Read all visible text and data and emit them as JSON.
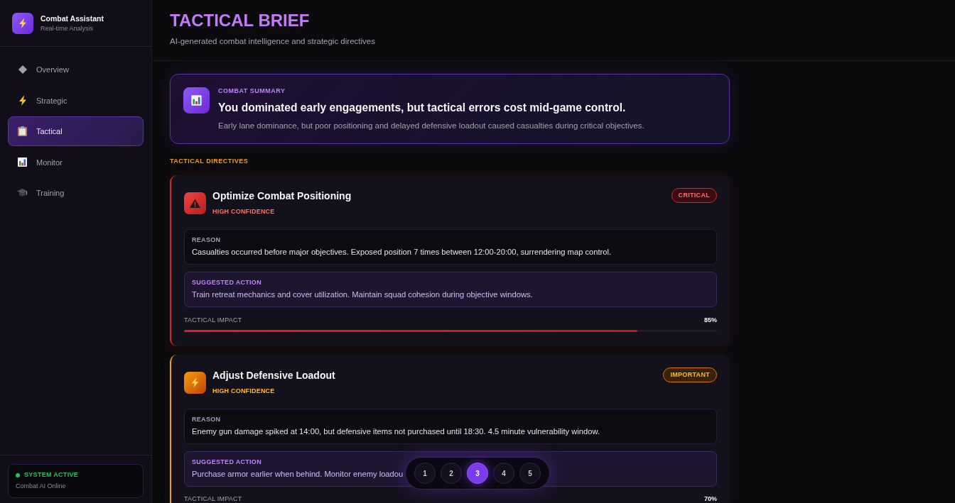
{
  "sidebar": {
    "app_title": "Combat Assistant",
    "app_subtitle": "Real-time Analysis",
    "nav_items": [
      {
        "label": "Overview",
        "selected": false
      },
      {
        "label": "Strategic",
        "selected": false
      },
      {
        "label": "Tactical",
        "selected": true
      },
      {
        "label": "Monitor",
        "selected": false
      },
      {
        "label": "Training",
        "selected": false
      }
    ],
    "status": {
      "label": "SYSTEM ACTIVE",
      "detail": "Combat AI Online"
    }
  },
  "header": {
    "title": "TACTICAL BRIEF",
    "subtitle": "AI-generated combat intelligence and strategic directives"
  },
  "summary": {
    "label": "COMBAT SUMMARY",
    "headline": "You dominated early engagements, but tactical errors cost mid-game control.",
    "description": "Early lane dominance, but poor positioning and delayed defensive loadout caused casualties during critical objectives."
  },
  "directives": {
    "heading": "TACTICAL DIRECTIVES",
    "items": [
      {
        "kind": "critical",
        "title": "Optimize Combat Positioning",
        "confidence": "HIGH CONFIDENCE",
        "badge": "CRITICAL",
        "reason_label": "REASON",
        "reason": "Casualties occurred before major objectives. Exposed position 7 times between 12:00-20:00, surrendering map control.",
        "action_label": "SUGGESTED ACTION",
        "action": "Train retreat mechanics and cover utilization. Maintain squad cohesion during objective windows.",
        "impact_label": "TACTICAL IMPACT",
        "impact": "85%",
        "level": 0.85
      },
      {
        "kind": "important",
        "title": "Adjust Defensive Loadout",
        "confidence": "HIGH CONFIDENCE",
        "badge": "IMPORTANT",
        "reason_label": "REASON",
        "reason": "Enemy gun damage spiked at 14:00, but defensive items not purchased until 18:30. 4.5 minute vulnerability window.",
        "action_label": "SUGGESTED ACTION",
        "action": "Purchase armor earlier when behind. Monitor enemy loadou",
        "impact_label": "TACTICAL IMPACT",
        "impact": "70%"
      }
    ]
  },
  "pager": {
    "pages": [
      {
        "label": "1",
        "selected": false
      },
      {
        "label": "2",
        "selected": false
      },
      {
        "label": "3",
        "selected": true
      },
      {
        "label": "4",
        "selected": false
      },
      {
        "label": "5",
        "selected": false
      }
    ]
  }
}
